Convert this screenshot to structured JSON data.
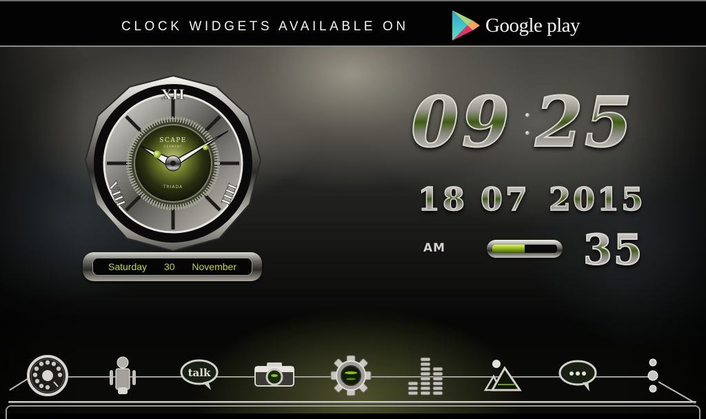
{
  "banner": {
    "text": "CLOCK WIDGETS AVAILABLE ON",
    "store_label": "Google play",
    "store_icon": "google-play-icon"
  },
  "analog_clock": {
    "brand": "SCAPE",
    "brand_sub": "GERMANY",
    "model": "TRIADA",
    "numerals": [
      "XII",
      "IIII",
      "VIII"
    ],
    "accent_color": "#9cb51e",
    "hour_hand_time": "10:10",
    "date_plate": {
      "weekday": "Saturday",
      "day": "30",
      "month": "November"
    }
  },
  "digital_clock": {
    "hours": "09",
    "minutes": "25",
    "day": "18",
    "month": "07",
    "year": "2015",
    "ampm": "AM",
    "seconds": "35",
    "battery_level_percent": 50,
    "accent_color": "#7fa61a"
  },
  "dock": {
    "items": [
      {
        "name": "phone",
        "icon": "rotary-phone-icon"
      },
      {
        "name": "android",
        "icon": "android-robot-icon"
      },
      {
        "name": "talk",
        "icon": "talk-bubble-icon",
        "label": "talk"
      },
      {
        "name": "camera",
        "icon": "camera-icon"
      },
      {
        "name": "settings",
        "icon": "gear-icon"
      },
      {
        "name": "music",
        "icon": "equalizer-icon"
      },
      {
        "name": "gallery",
        "icon": "mountain-image-icon"
      },
      {
        "name": "messaging",
        "icon": "chat-bubble-icon"
      },
      {
        "name": "menu",
        "icon": "more-vertical-icon"
      }
    ]
  }
}
